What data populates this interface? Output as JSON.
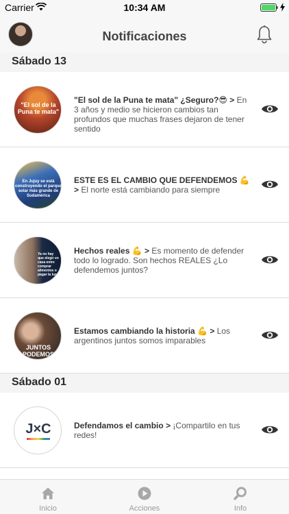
{
  "status_bar": {
    "carrier": "Carrier",
    "time": "10:34 AM"
  },
  "nav": {
    "title": "Notificaciones",
    "avatar_icon": "user-avatar",
    "bell_icon": "bell-icon"
  },
  "sections": [
    {
      "label": "Sábado 13"
    },
    {
      "label": "Sábado 01"
    }
  ],
  "notifications": [
    {
      "title": "\"El sol de la Puna te mata\" ¿Seguro?😎",
      "body": "En 3 años y medio se hicieron cambios tan profundos que muchas frases dejaron de tener sentido",
      "thumb_text": "\"El sol de la Puna te mata\""
    },
    {
      "title": "ESTE ES EL CAMBIO QUE DEFENDEMOS 💪",
      "body": "El norte está cambiando para siempre",
      "thumb_text": "En Jujuy se está construyendo el parque solar más grande de Sudamérica"
    },
    {
      "title": "Hechos reales 💪",
      "body": "Es momento de defender todo lo logrado. Son hechos REALES ¿Lo defendemos juntos?",
      "thumb_text": "Ya no hay que elegir en casa entre comprar alimentos o pagar la luz"
    },
    {
      "title": "Estamos cambiando la historia 💪",
      "body": "Los argentinos juntos somos imparables",
      "thumb_text": "JUNTOS PODEMOS"
    },
    {
      "title": "Defendamos el cambio",
      "body": "¡Compartilo en tus redes!",
      "thumb_text": "J×C"
    }
  ],
  "tabs": [
    {
      "label": "Inicio",
      "icon": "home-icon"
    },
    {
      "label": "Acciones",
      "icon": "play-circle-icon"
    },
    {
      "label": "Info",
      "icon": "search-icon"
    }
  ],
  "colors": {
    "bar_bg": "#f7f7f7",
    "section_bg": "#f4f4f4",
    "tab_inactive": "#999999",
    "battery_green": "#4cd964"
  }
}
